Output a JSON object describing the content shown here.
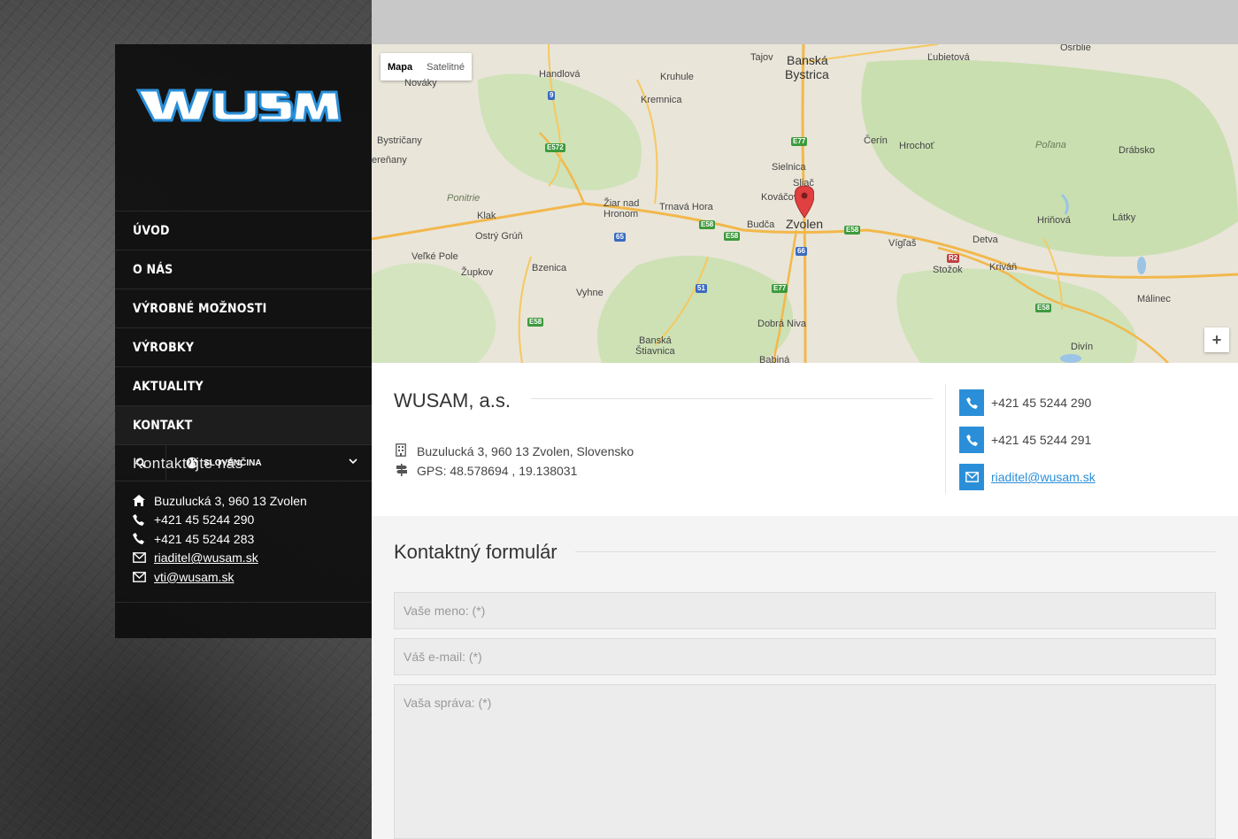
{
  "brand": {
    "logo_text": "WUSAM",
    "accent_color": "#2a8fd8"
  },
  "nav": {
    "items": [
      {
        "label": "ÚVOD"
      },
      {
        "label": "O NÁS"
      },
      {
        "label": "VÝROBNÉ MOŽNOSTI"
      },
      {
        "label": "VÝROBKY"
      },
      {
        "label": "AKTUALITY"
      },
      {
        "label": "KONTAKT"
      }
    ],
    "active": "KONTAKT"
  },
  "tools": {
    "search_icon": "search-icon",
    "language": "SLOVENČINA"
  },
  "sidebar_contact": {
    "heading": "Kontaktujte nás",
    "address": "Buzulucká 3, 960 13 Zvolen",
    "phone1": "+421 45 5244 290",
    "phone2": "+421 45 5244 283",
    "email1": "riaditel@wusam.sk",
    "email2": "vti@wusam.sk"
  },
  "map": {
    "type_map": "Mapa",
    "type_satellite": "Satelitné",
    "zoom_in": "+",
    "places": {
      "banska": "Banská",
      "bystrica": "Bystrica",
      "zvolen": "Zvolen",
      "handlova": "Handlová",
      "novaky": "Nováky",
      "kremnica": "Kremnica",
      "kremnica_l": "Kremnica",
      "kruhule": "Kruhule",
      "tajov": "Tajov",
      "lubietova": "Ľubietová",
      "osrblie": "Osrblie",
      "bystricany": "Bystričany",
      "erenany": "ereňany",
      "cerin": "Čerín",
      "hrochot": "Hrochoť",
      "polana": "Poľana",
      "drabsko": "Drábsko",
      "sielnica": "Sielnica",
      "sliac": "Sliač",
      "kovacova": "Kováčová",
      "pontrie": "Ponitrie",
      "ziar": "Žiar nad",
      "hronom": "Hronom",
      "trnava_hora": "Trnavá Hora",
      "klak": "Klak",
      "ostry_grun": "Ostrý Grúň",
      "budca": "Budča",
      "vigles": "Vígľaš",
      "detva": "Detva",
      "hrinova": "Hriňová",
      "latky": "Látky",
      "velke_pole": "Veľké Pole",
      "zupkov": "Župkov",
      "bzenica": "Bzenica",
      "stozok": "Stožok",
      "krivan": "Kriváň",
      "vyhne": "Vyhne",
      "malinec": "Málinec",
      "dobra_niva": "Dobrá Niva",
      "banska2": "Banská",
      "stiavnica": "Štiavnica",
      "babina": "Babiná",
      "divin": "Divín"
    },
    "shields": {
      "s9": "9",
      "e572": "E572",
      "e77a": "E77",
      "e58a": "E58",
      "e58b": "E58",
      "e58c": "E58",
      "s65": "65",
      "s66": "66",
      "e77b": "E77",
      "s51": "51",
      "e58d": "E58",
      "e58e": "E58",
      "r2": "R2"
    }
  },
  "company": {
    "name": "WUSAM, a.s.",
    "address": "Buzulucká 3, 960 13 Zvolen, Slovensko",
    "gps": "GPS: 48.578694 , 19.138031",
    "phone1": "+421 45 5244 290",
    "phone2": "+421 45 5244 291",
    "email": "riaditel@wusam.sk"
  },
  "form": {
    "title": "Kontaktný formulár",
    "name_placeholder": "Vaše meno: (*)",
    "email_placeholder": "Váš e-mail: (*)",
    "message_placeholder": "Vaša správa: (*)"
  }
}
